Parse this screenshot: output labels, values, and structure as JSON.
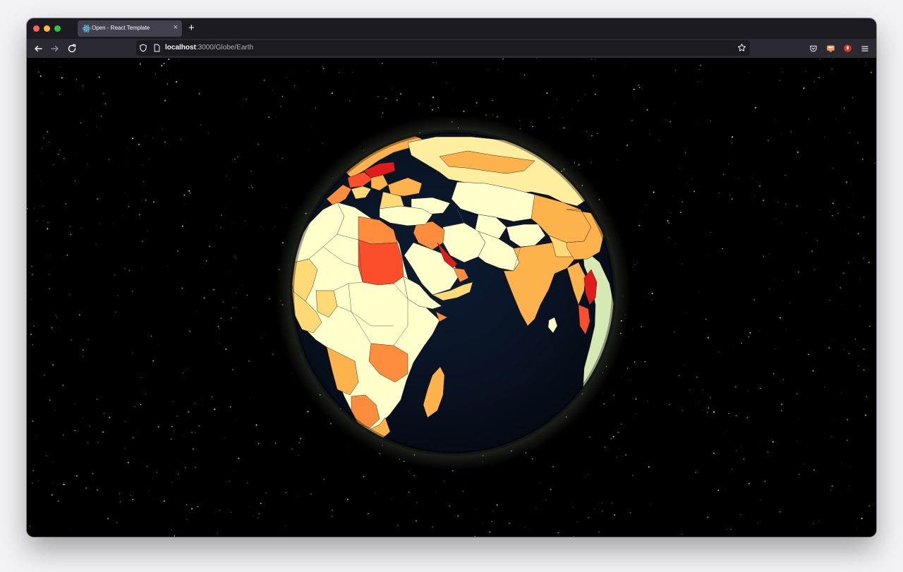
{
  "browser": {
    "tab": {
      "title": "Open - React Template",
      "close_icon": "close-icon",
      "favicon_icon": "react-logo-icon"
    },
    "new_tab_label": "+",
    "url": {
      "host": "localhost",
      "path": ":3000/Globe/Earth"
    },
    "icons": {
      "back": "arrow-left-icon",
      "forward": "arrow-right-icon",
      "reload": "reload-icon",
      "shield": "shield-icon",
      "page": "page-icon",
      "bookmark": "star-icon",
      "pocket": "pocket-icon",
      "extension1": "extension-icon",
      "extension2": "extension-icon",
      "menu": "hamburger-menu-icon"
    }
  },
  "scene": {
    "background_color": "#000000",
    "ocean_color": "#0a1525",
    "atmosphere_color": "#d8ecc8",
    "country_palette": [
      "#ffffcc",
      "#ffeda0",
      "#fed976",
      "#feb24c",
      "#fd8d3c",
      "#fc4e2a",
      "#e31a1c"
    ]
  }
}
